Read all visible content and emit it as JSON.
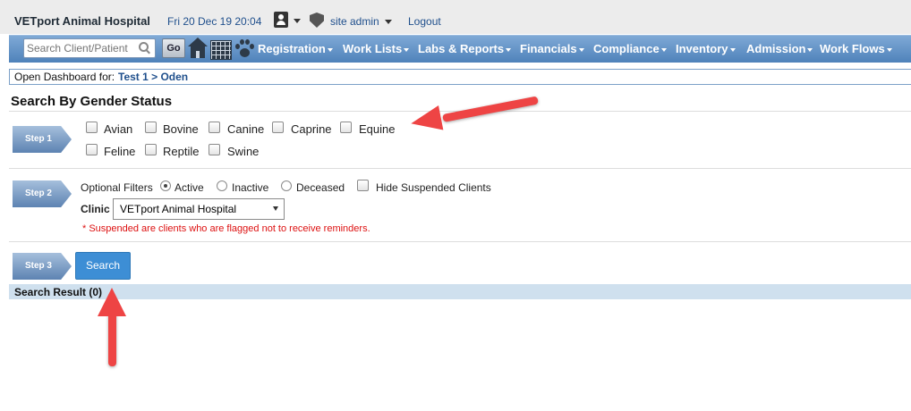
{
  "header": {
    "hospital": "VETport Animal Hospital",
    "datetime": "Fri 20 Dec 19 20:04",
    "user": "site admin",
    "logout": "Logout"
  },
  "navbar": {
    "search_placeholder": "Search Client/Patient",
    "go": "Go",
    "menus": [
      "Registration",
      "Work Lists",
      "Labs & Reports",
      "Financials",
      "Compliance",
      "Inventory",
      "Admission",
      "Work Flows"
    ]
  },
  "dashboard": {
    "label": "Open Dashboard for:",
    "patient": "Test 1 > Oden"
  },
  "page_title": "Search By Gender Status",
  "step1": {
    "label": "Step 1",
    "species": [
      "Avian",
      "Bovine",
      "Canine",
      "Caprine",
      "Equine",
      "Feline",
      "Reptile",
      "Swine"
    ]
  },
  "step2": {
    "label": "Step 2",
    "optional_filters": "Optional Filters",
    "status_options": [
      "Active",
      "Inactive",
      "Deceased"
    ],
    "selected_status": "Active",
    "hide_suspended": "Hide Suspended Clients",
    "clinic_label": "Clinic",
    "clinic_value": "VETport Animal Hospital",
    "note": "* Suspended are clients who are flagged not to receive reminders."
  },
  "step3": {
    "label": "Step 3",
    "search_button": "Search"
  },
  "result": "Search Result (0)",
  "colors": {
    "nav_top": "#7fa9d6",
    "nav_bottom": "#4f82ba",
    "link": "#1f4f8c",
    "button": "#3d8ed5",
    "annotation_arrow": "#ee4444",
    "note": "#dd1111"
  }
}
